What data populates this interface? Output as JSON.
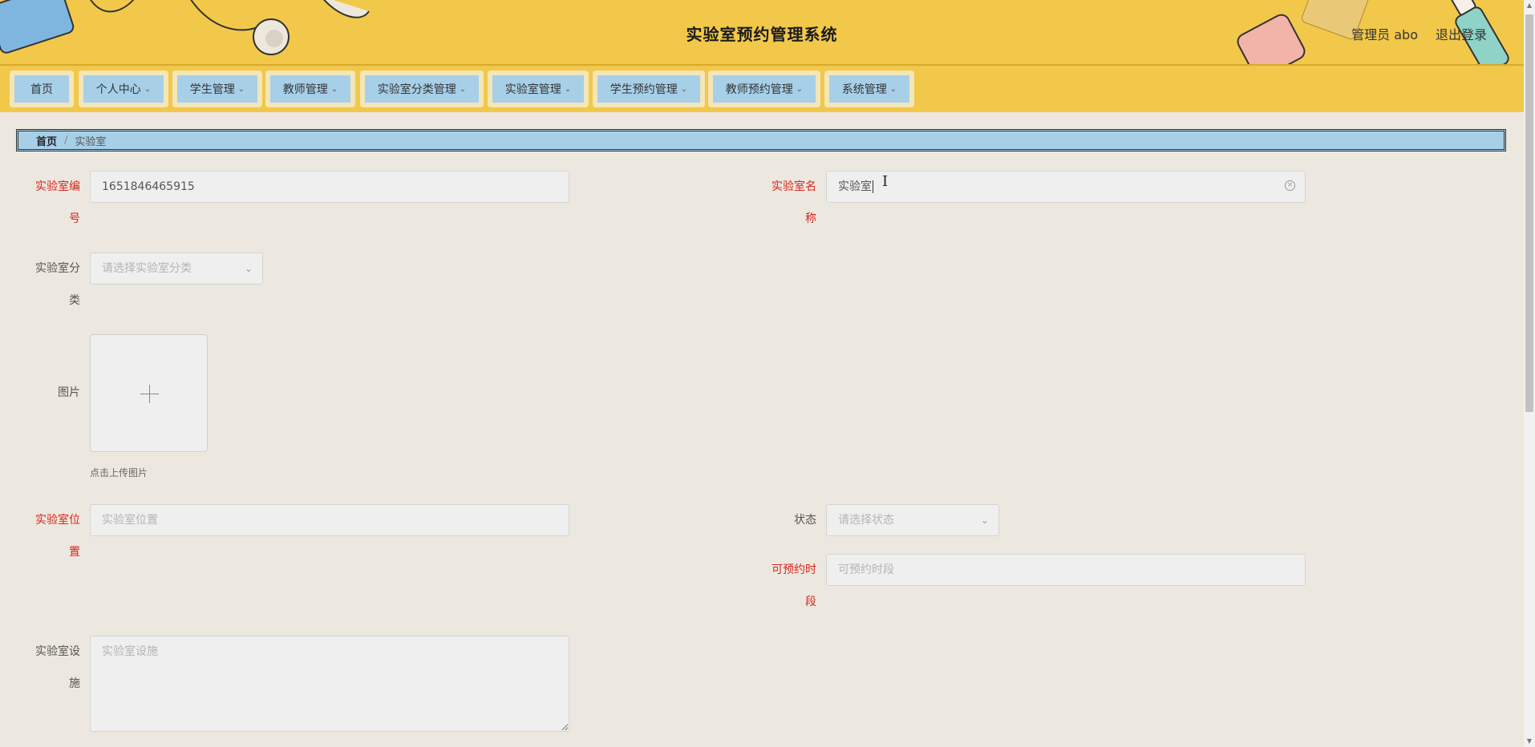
{
  "header": {
    "title": "实验室预约管理系统",
    "user": "管理员 abo",
    "logout": "退出登录"
  },
  "nav": {
    "items": [
      {
        "label": "首页",
        "has_dropdown": false
      },
      {
        "label": "个人中心",
        "has_dropdown": true
      },
      {
        "label": "学生管理",
        "has_dropdown": true
      },
      {
        "label": "教师管理",
        "has_dropdown": true
      },
      {
        "label": "实验室分类管理",
        "has_dropdown": true
      },
      {
        "label": "实验室管理",
        "has_dropdown": true
      },
      {
        "label": "学生预约管理",
        "has_dropdown": true
      },
      {
        "label": "教师预约管理",
        "has_dropdown": true
      },
      {
        "label": "系统管理",
        "has_dropdown": true
      }
    ]
  },
  "breadcrumb": {
    "home": "首页",
    "separator": "/",
    "current": "实验室"
  },
  "form": {
    "lab_no": {
      "label_line1": "实验室编",
      "label_line2": "号",
      "value": "1651846465915",
      "required": true
    },
    "lab_name": {
      "label_line1": "实验室名",
      "label_line2": "称",
      "value": "实验室",
      "required": true
    },
    "category": {
      "label_line1": "实验室分",
      "label_line2": "类",
      "placeholder": "请选择实验室分类"
    },
    "image": {
      "label": "图片",
      "tip": "点击上传图片"
    },
    "location": {
      "label_line1": "实验室位",
      "label_line2": "置",
      "placeholder": "实验室位置",
      "required": true
    },
    "status": {
      "label": "状态",
      "placeholder": "请选择状态"
    },
    "slots": {
      "label_line1": "可预约时",
      "label_line2": "段",
      "placeholder": "可预约时段",
      "required": true
    },
    "equipment": {
      "label_line1": "实验室设",
      "label_line2": "施",
      "placeholder": "实验室设施"
    }
  },
  "icons": {
    "dropdown": "chevron-down-icon",
    "clear": "clear-circle-icon",
    "upload": "plus-icon"
  },
  "colors": {
    "header_bg": "#f2c84a",
    "nav_button_bg": "#a7cfe8",
    "required_label": "#d9231d",
    "page_bg": "#ede8df"
  }
}
